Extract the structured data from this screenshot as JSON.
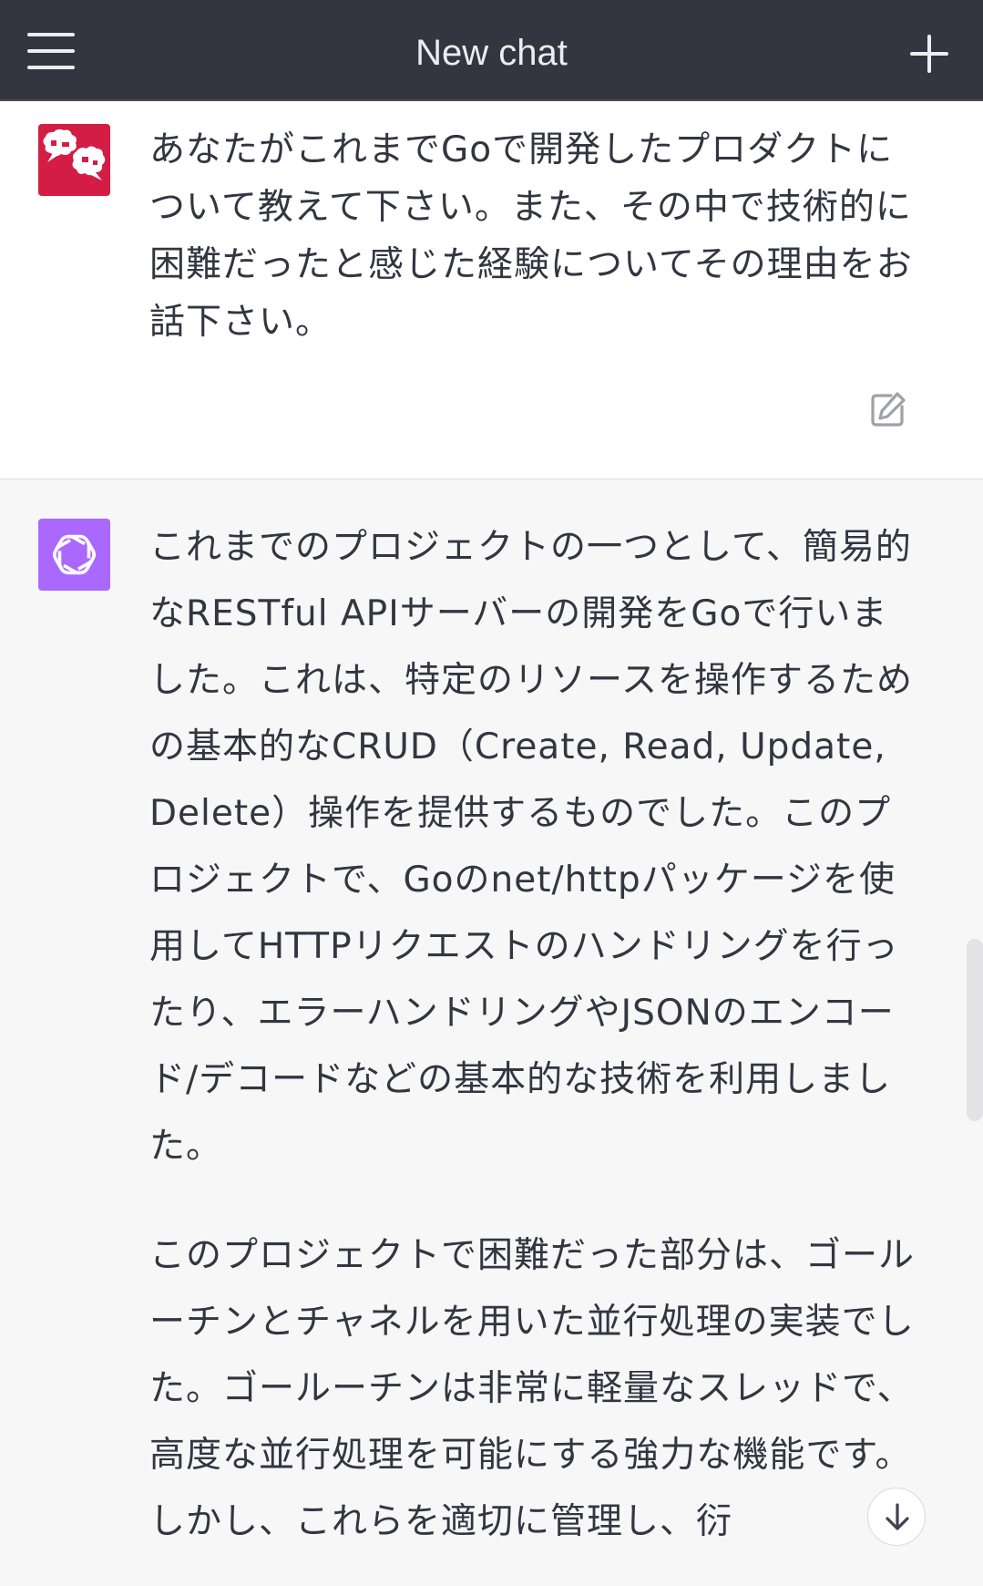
{
  "header": {
    "title": "New chat",
    "menu_icon": "hamburger-menu-icon",
    "new_chat_icon": "plus-icon"
  },
  "user_message": {
    "avatar_icon": "user-avatar-speech-bubbles",
    "text": "あなたがこれまでGoで開発したプロダクトについて教えて下さい。また、その中で技術的に困難だったと感じた経験についてその理由をお話下さい。",
    "edit_icon": "edit-icon"
  },
  "assistant_message": {
    "avatar_icon": "openai-logo-icon",
    "paragraphs": [
      "これまでのプロジェクトの一つとして、簡易的なRESTful APIサーバーの開発をGoで行いました。これは、特定のリソースを操作するための基本的なCRUD（Create, Read, Update, Delete）操作を提供するものでした。このプロジェクトで、Goのnet/httpパッケージを使用してHTTPリクエストのハンドリングを行ったり、エラーハンドリングやJSONのエンコード/デコードなどの基本的な技術を利用しました。",
      "このプロジェクトで困難だった部分は、ゴールーチンとチャネルを用いた並行処理の実装でした。ゴールーチンは非常に軽量なスレッドで、高度な並行処理を可能にする強力な機能です。しかし、これらを適切に管理し、衍"
    ]
  },
  "scroll_down_icon": "arrow-down-icon",
  "colors": {
    "header_bg": "#343541",
    "user_avatar_bg": "#d41d45",
    "assistant_avatar_bg": "#ab68ff",
    "assistant_bg": "#f7f7f8"
  }
}
